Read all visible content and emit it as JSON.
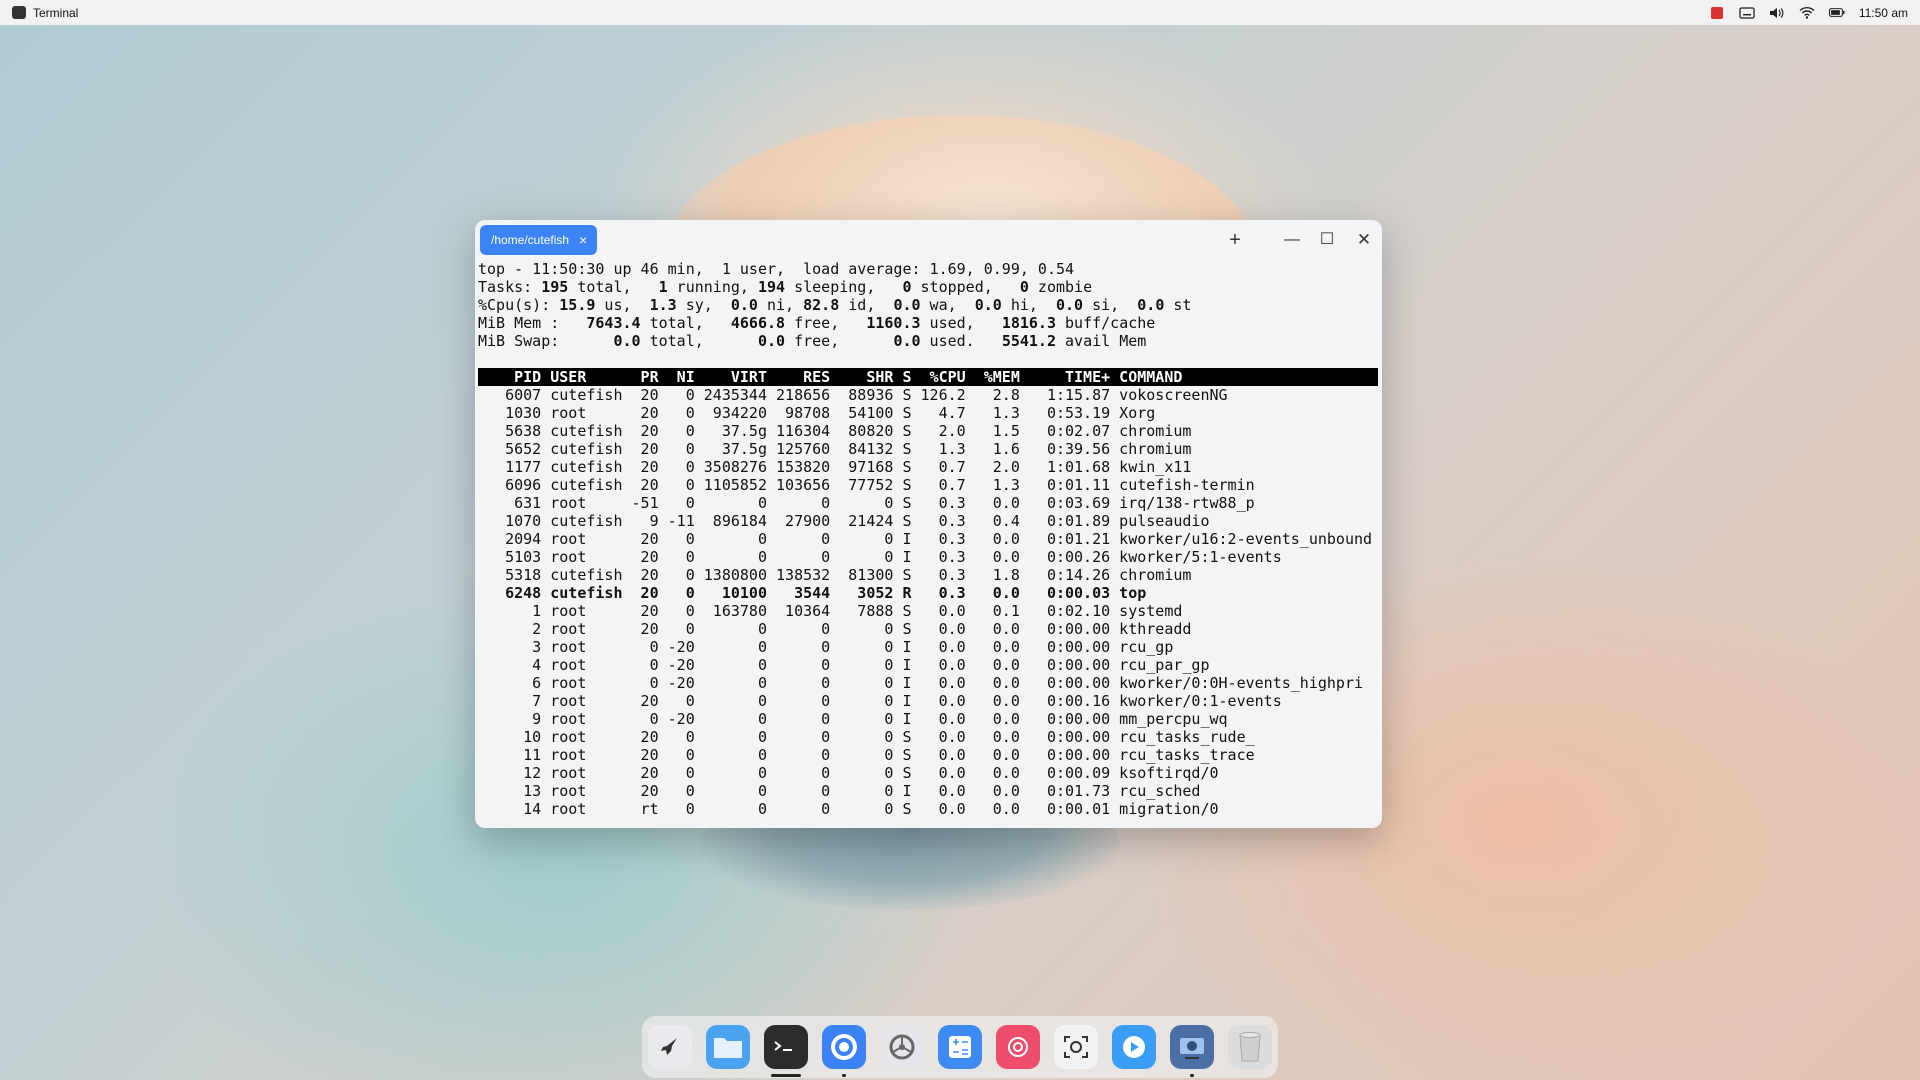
{
  "topbar": {
    "app_name": "Terminal",
    "time": "11:50 am"
  },
  "window": {
    "tab_label": "/home/cutefish",
    "tab_close": "×",
    "new_tab": "+",
    "minimize": "—",
    "maximize": "☐",
    "close": "✕"
  },
  "top_summary": [
    [
      {
        "t": "top - 11:50:30 up 46 min,  1 user,  load average: 1.69, 0.99, 0.54"
      }
    ],
    [
      {
        "t": "Tasks: "
      },
      {
        "t": "195",
        "b": true
      },
      {
        "t": " total,   "
      },
      {
        "t": "1",
        "b": true
      },
      {
        "t": " running, "
      },
      {
        "t": "194",
        "b": true
      },
      {
        "t": " sleeping,   "
      },
      {
        "t": "0",
        "b": true
      },
      {
        "t": " stopped,   "
      },
      {
        "t": "0",
        "b": true
      },
      {
        "t": " zombie"
      }
    ],
    [
      {
        "t": "%Cpu(s): "
      },
      {
        "t": "15.9",
        "b": true
      },
      {
        "t": " us,  "
      },
      {
        "t": "1.3",
        "b": true
      },
      {
        "t": " sy,  "
      },
      {
        "t": "0.0",
        "b": true
      },
      {
        "t": " ni, "
      },
      {
        "t": "82.8",
        "b": true
      },
      {
        "t": " id,  "
      },
      {
        "t": "0.0",
        "b": true
      },
      {
        "t": " wa,  "
      },
      {
        "t": "0.0",
        "b": true
      },
      {
        "t": " hi,  "
      },
      {
        "t": "0.0",
        "b": true
      },
      {
        "t": " si,  "
      },
      {
        "t": "0.0",
        "b": true
      },
      {
        "t": " st"
      }
    ],
    [
      {
        "t": "MiB Mem :   "
      },
      {
        "t": "7643.4",
        "b": true
      },
      {
        "t": " total,   "
      },
      {
        "t": "4666.8",
        "b": true
      },
      {
        "t": " free,   "
      },
      {
        "t": "1160.3",
        "b": true
      },
      {
        "t": " used,   "
      },
      {
        "t": "1816.3",
        "b": true
      },
      {
        "t": " buff/cache"
      }
    ],
    [
      {
        "t": "MiB Swap:      "
      },
      {
        "t": "0.0",
        "b": true
      },
      {
        "t": " total,      "
      },
      {
        "t": "0.0",
        "b": true
      },
      {
        "t": " free,      "
      },
      {
        "t": "0.0",
        "b": true
      },
      {
        "t": " used.   "
      },
      {
        "t": "5541.2",
        "b": true
      },
      {
        "t": " avail Mem"
      }
    ]
  ],
  "process_header": "    PID USER      PR  NI    VIRT    RES    SHR S  %CPU  %MEM     TIME+ COMMAND",
  "processes": [
    {
      "line": "   6007 cutefish  20   0 2435344 218656  88936 S 126.2   2.8   1:15.87 vokoscreenNG",
      "bold": false
    },
    {
      "line": "   1030 root      20   0  934220  98708  54100 S   4.7   1.3   0:53.19 Xorg",
      "bold": false
    },
    {
      "line": "   5638 cutefish  20   0   37.5g 116304  80820 S   2.0   1.5   0:02.07 chromium",
      "bold": false
    },
    {
      "line": "   5652 cutefish  20   0   37.5g 125760  84132 S   1.3   1.6   0:39.56 chromium",
      "bold": false
    },
    {
      "line": "   1177 cutefish  20   0 3508276 153820  97168 S   0.7   2.0   1:01.68 kwin_x11",
      "bold": false
    },
    {
      "line": "   6096 cutefish  20   0 1105852 103656  77752 S   0.7   1.3   0:01.11 cutefish-termin",
      "bold": false
    },
    {
      "line": "    631 root     -51   0       0      0      0 S   0.3   0.0   0:03.69 irq/138-rtw88_p",
      "bold": false
    },
    {
      "line": "   1070 cutefish   9 -11  896184  27900  21424 S   0.3   0.4   0:01.89 pulseaudio",
      "bold": false
    },
    {
      "line": "   2094 root      20   0       0      0      0 I   0.3   0.0   0:01.21 kworker/u16:2-events_unbound",
      "bold": false
    },
    {
      "line": "   5103 root      20   0       0      0      0 I   0.3   0.0   0:00.26 kworker/5:1-events",
      "bold": false
    },
    {
      "line": "   5318 cutefish  20   0 1380800 138532  81300 S   0.3   1.8   0:14.26 chromium",
      "bold": false
    },
    {
      "line": "   6248 cutefish  20   0   10100   3544   3052 R   0.3   0.0   0:00.03 top",
      "bold": true
    },
    {
      "line": "      1 root      20   0  163780  10364   7888 S   0.0   0.1   0:02.10 systemd",
      "bold": false
    },
    {
      "line": "      2 root      20   0       0      0      0 S   0.0   0.0   0:00.00 kthreadd",
      "bold": false
    },
    {
      "line": "      3 root       0 -20       0      0      0 I   0.0   0.0   0:00.00 rcu_gp",
      "bold": false
    },
    {
      "line": "      4 root       0 -20       0      0      0 I   0.0   0.0   0:00.00 rcu_par_gp",
      "bold": false
    },
    {
      "line": "      6 root       0 -20       0      0      0 I   0.0   0.0   0:00.00 kworker/0:0H-events_highpri",
      "bold": false
    },
    {
      "line": "      7 root      20   0       0      0      0 I   0.0   0.0   0:00.16 kworker/0:1-events",
      "bold": false
    },
    {
      "line": "      9 root       0 -20       0      0      0 I   0.0   0.0   0:00.00 mm_percpu_wq",
      "bold": false
    },
    {
      "line": "     10 root      20   0       0      0      0 S   0.0   0.0   0:00.00 rcu_tasks_rude_",
      "bold": false
    },
    {
      "line": "     11 root      20   0       0      0      0 S   0.0   0.0   0:00.00 rcu_tasks_trace",
      "bold": false
    },
    {
      "line": "     12 root      20   0       0      0      0 S   0.0   0.0   0:00.09 ksoftirqd/0",
      "bold": false
    },
    {
      "line": "     13 root      20   0       0      0      0 I   0.0   0.0   0:01.73 rcu_sched",
      "bold": false
    },
    {
      "line": "     14 root      rt   0       0      0      0 S   0.0   0.0   0:00.01 migration/0",
      "bold": false
    }
  ],
  "dock": [
    {
      "name": "launcher-icon",
      "color": "#e9e9ee",
      "active": false
    },
    {
      "name": "file-manager-icon",
      "color": "#4ba3f0",
      "active": false
    },
    {
      "name": "terminal-icon",
      "color": "#2c2c2c",
      "active": true
    },
    {
      "name": "chromium-icon",
      "color": "#3b82f6",
      "active": true
    },
    {
      "name": "settings-icon",
      "color": "#e6e6ea",
      "active": false
    },
    {
      "name": "calculator-icon",
      "color": "#3d8bf2",
      "active": false
    },
    {
      "name": "music-icon",
      "color": "#ef4d6b",
      "active": false
    },
    {
      "name": "screenshot-icon",
      "color": "#f2f2f4",
      "active": false
    },
    {
      "name": "video-player-icon",
      "color": "#3a9df7",
      "active": false
    },
    {
      "name": "screen-recorder-icon",
      "color": "#4a6fa5",
      "active": true
    },
    {
      "name": "trash-icon",
      "color": "#dcdcdc",
      "active": false
    }
  ]
}
